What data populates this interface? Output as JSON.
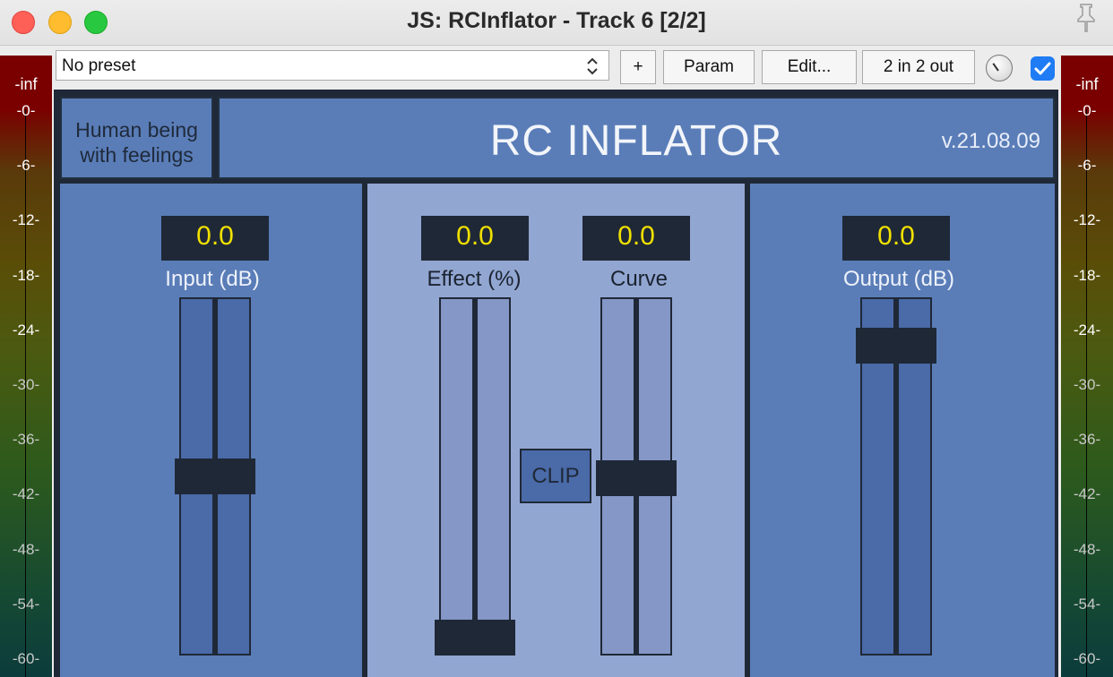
{
  "window": {
    "title": "JS: RCInflator - Track 6 [2/2]"
  },
  "toolbar": {
    "preset": "No preset",
    "add_label": "+",
    "param_label": "Param",
    "edit_label": "Edit...",
    "io_label": "2 in 2 out",
    "enabled": true
  },
  "meters": {
    "inf_label": "-inf",
    "ticks": [
      "-0-",
      "-6-",
      "-12-",
      "-18-",
      "-24-",
      "-30-",
      "-36-",
      "-42-",
      "-48-",
      "-54-",
      "-60-"
    ]
  },
  "plugin": {
    "author_line1": "Human being",
    "author_line2": "with feelings",
    "brand": "RC INFLATOR",
    "version": "v.21.08.09",
    "input": {
      "value": "0.0",
      "label": "Input (dB)"
    },
    "effect": {
      "value": "0.0",
      "label": "Effect (%)"
    },
    "curve": {
      "value": "0.0",
      "label": "Curve"
    },
    "output": {
      "value": "0.0",
      "label": "Output (dB)"
    },
    "clip_label": "CLIP"
  },
  "colors": {
    "panel_blue": "#5a7db8",
    "panel_light": "#92a6d2",
    "display_text": "#f0e000",
    "checkbox": "#1f7cf5"
  }
}
